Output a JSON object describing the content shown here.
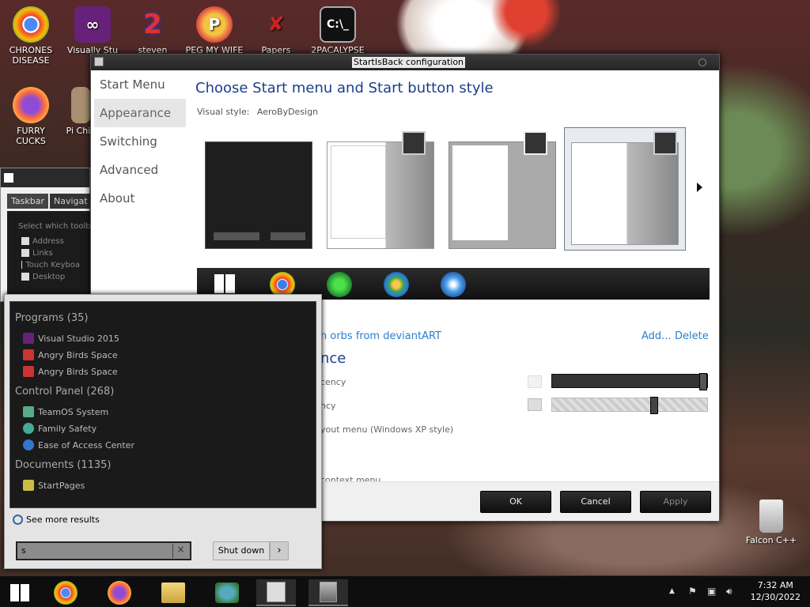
{
  "desktop": {
    "icons": [
      {
        "label": "CHRONES DISEASE",
        "icon": "chrome-icon"
      },
      {
        "label": "Visually Stu",
        "icon": "visual-studio-icon"
      },
      {
        "label": "steven",
        "icon": "steven-icon"
      },
      {
        "label": "PEG MY WIFE",
        "icon": "peg-icon"
      },
      {
        "label": "Papers",
        "icon": "papers-icon"
      },
      {
        "label": "2PACALYPSE",
        "icon": "terminal-icon"
      },
      {
        "label": "FURRY CUCKS",
        "icon": "firefox-icon"
      },
      {
        "label": "Pi Chic",
        "icon": "pi-icon"
      },
      {
        "label": "Falcon C++",
        "icon": "recycle-bin-icon"
      }
    ]
  },
  "config_window": {
    "title": "StartIsBack configuration",
    "nav": [
      "Start Menu",
      "Appearance",
      "Switching",
      "Advanced",
      "About"
    ],
    "selected_nav": "Appearance",
    "heading": "Choose Start menu and Start button style",
    "visual_style_label": "Visual style:",
    "visual_style_value": "AeroByDesign",
    "orb_link": "n orbs from deviantART",
    "add_link": "Add...",
    "delete_link": "Delete",
    "section_title": "nce",
    "rows": [
      "cency",
      "ncy",
      "yout menu (Windows XP style)",
      "context menu"
    ],
    "slider1_value": 1.0,
    "slider2_value": 0.65,
    "buttons": {
      "ok": "OK",
      "cancel": "Cancel",
      "apply": "Apply"
    }
  },
  "aux_window": {
    "tabs": [
      "Taskbar",
      "Navigat"
    ],
    "label": "Select which toolba",
    "items": [
      "Address",
      "Links",
      "Touch Keyboa",
      "Desktop"
    ]
  },
  "start_menu": {
    "groups": [
      {
        "title": "Programs (35)",
        "items": [
          "Visual Studio 2015",
          "Angry Birds Space",
          "Angry Birds Space"
        ]
      },
      {
        "title": "Control Panel (268)",
        "items": [
          "TeamOS System",
          "Family Safety",
          "Ease of Access Center"
        ]
      },
      {
        "title": "Documents (1135)",
        "items": [
          "StartPages"
        ]
      }
    ],
    "see_more": "See more results",
    "search_value": "s",
    "shutdown_label": "Shut down"
  },
  "taskbar": {
    "time": "7:32 AM",
    "date": "12/30/2022",
    "tray_arrow": "▲"
  }
}
